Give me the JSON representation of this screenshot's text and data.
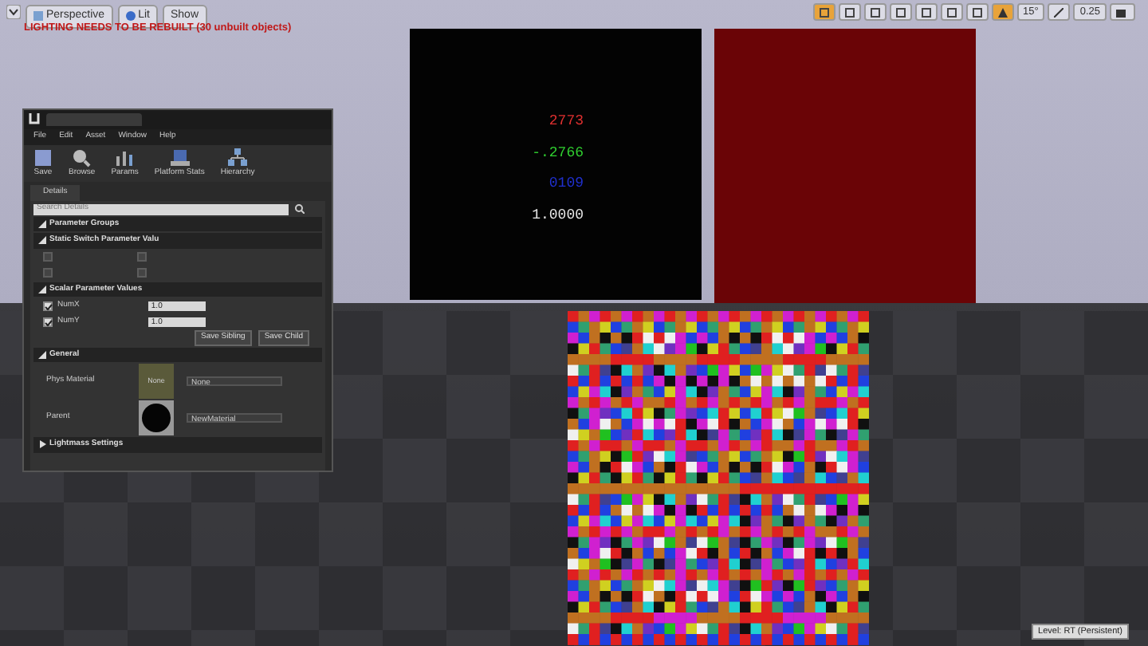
{
  "viewport": {
    "toolbar": [
      {
        "label": "Perspective",
        "kind": "camera"
      },
      {
        "label": "Lit",
        "kind": "lit"
      },
      {
        "label": "Show",
        "kind": "plain"
      }
    ],
    "warning": "LIGHTING NEEDS TO BE REBUILT (30 unbuilt objects)",
    "right_toolbar": {
      "angle": "15°",
      "scale": "0.25"
    },
    "value_readout": [
      {
        "text": "2773",
        "color": "#e03030"
      },
      {
        "text": "-.2766",
        "color": "#30d030"
      },
      {
        "text": "0109",
        "color": "#2030d0"
      },
      {
        "text": "1.0000",
        "color": "#e8e8e8"
      }
    ],
    "level_label": "Level: RT (Persistent)"
  },
  "editor": {
    "menu": [
      "File",
      "Edit",
      "Asset",
      "Window",
      "Help"
    ],
    "toolbar": [
      {
        "label": "Save",
        "kind": "save"
      },
      {
        "label": "Browse",
        "kind": "browse"
      },
      {
        "label": "Params",
        "kind": "params"
      },
      {
        "label": "Platform Stats",
        "kind": "stats"
      },
      {
        "label": "Hierarchy",
        "kind": "hierarchy"
      }
    ],
    "details_tab": "Details",
    "search": {
      "placeholder": "Search Details"
    },
    "sections": [
      {
        "title": "Parameter Groups",
        "expanded": true
      },
      {
        "title": "Static Switch Parameter Valu",
        "expanded": true
      }
    ],
    "switch_rows": [
      {
        "checked": false,
        "disabled": true,
        "value_checked": false
      },
      {
        "checked": false,
        "disabled": true,
        "value_checked": false
      }
    ],
    "scalar_title": "Scalar Parameter Values",
    "scalars": [
      {
        "name": "NumX",
        "checked": true,
        "value": "1.0"
      },
      {
        "name": "NumY",
        "checked": true,
        "value": "1.0"
      }
    ],
    "buttons": [
      "Save Sibling",
      "Save Child"
    ],
    "general": {
      "title": "General",
      "phys_label": "Phys Material",
      "phys_thumb": "None",
      "phys_value": "None",
      "parent_label": "Parent",
      "parent_value": "NewMaterial"
    },
    "collapsed_section": {
      "title": "Lightmass Settings",
      "expanded": false
    }
  }
}
